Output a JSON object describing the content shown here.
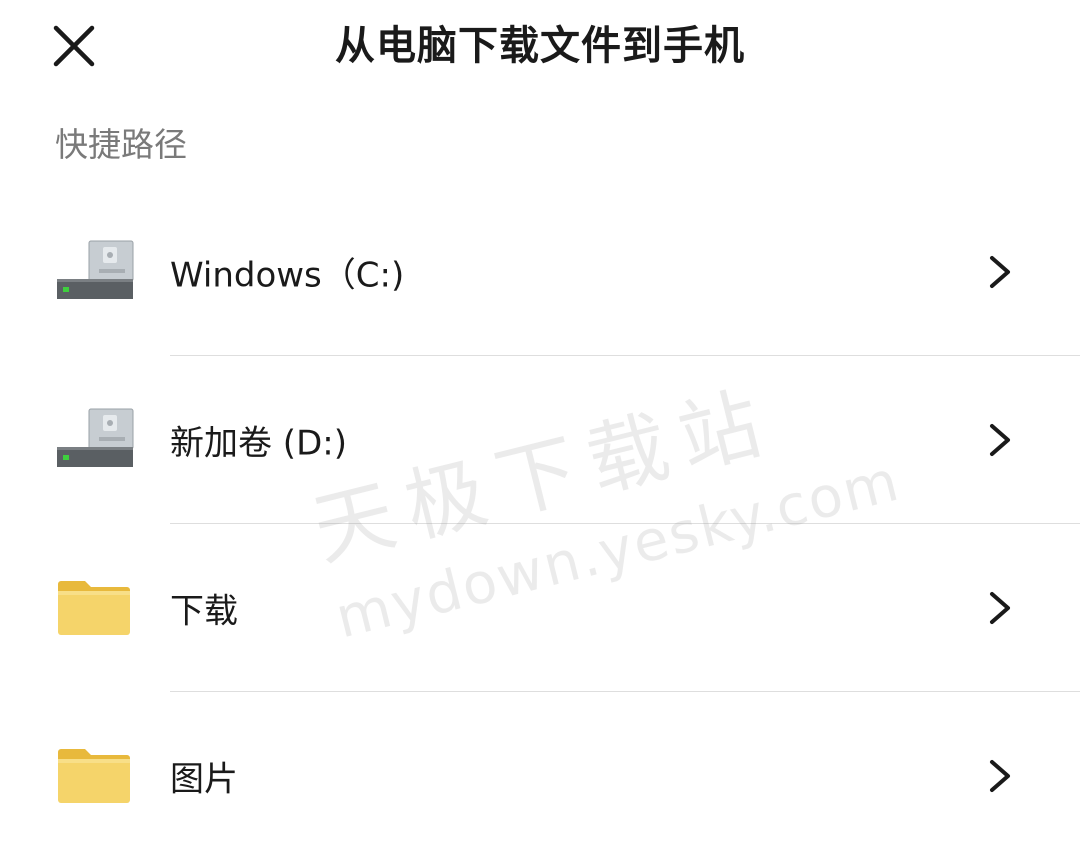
{
  "header": {
    "title": "从电脑下载文件到手机",
    "close_icon": "close-icon"
  },
  "section": {
    "label": "快捷路径"
  },
  "items": [
    {
      "label": "Windows（C:)",
      "icon": "drive-icon"
    },
    {
      "label": "新加卷 (D:)",
      "icon": "drive-icon"
    },
    {
      "label": "下载",
      "icon": "folder-icon"
    },
    {
      "label": "图片",
      "icon": "folder-icon"
    }
  ],
  "watermark": {
    "cn": "天极下载站",
    "en": "mydown.yesky.com"
  },
  "colors": {
    "title": "#1a1a1a",
    "section_label": "#7a7a7a",
    "divider": "#dedede",
    "folder": "#f5d46a",
    "drive_led": "#3ecf3e"
  }
}
